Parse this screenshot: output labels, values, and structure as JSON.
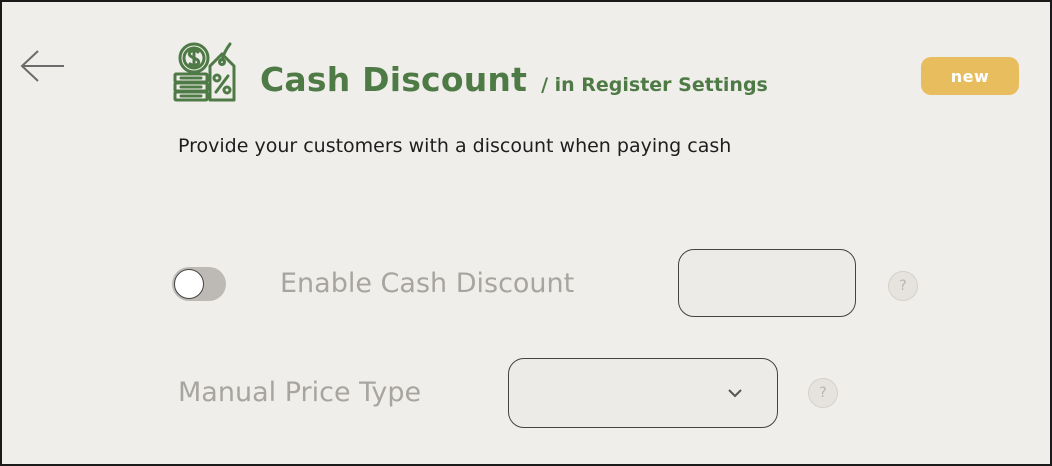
{
  "header": {
    "title": "Cash Discount",
    "location": "/ in Register Settings",
    "badge": "new",
    "description": "Provide your customers with a discount when paying cash",
    "icon": "cash-discount-icon"
  },
  "settings": {
    "enable_cash_discount": {
      "label": "Enable Cash Discount",
      "enabled": false,
      "value": "",
      "help": "?"
    },
    "manual_price_type": {
      "label": "Manual Price Type",
      "selected": "",
      "help": "?"
    }
  },
  "colors": {
    "accent_green": "#4e7a45",
    "badge_yellow": "#e8bd5e",
    "background": "#f0eeeb",
    "disabled_text": "#a8a5a0"
  }
}
